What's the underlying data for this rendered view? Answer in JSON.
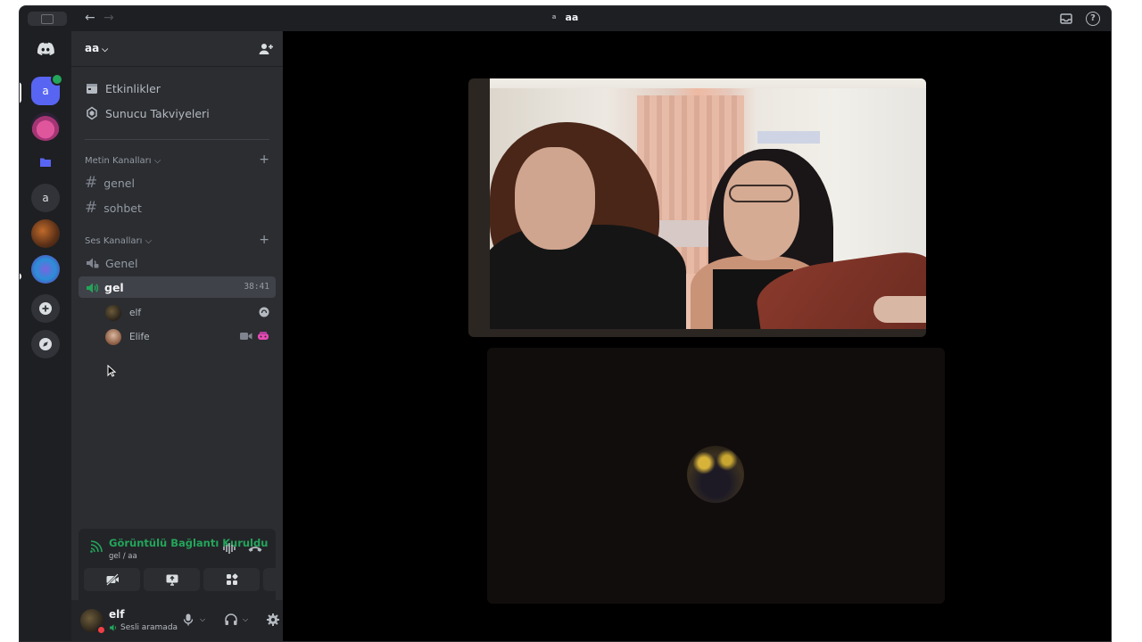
{
  "titlebar": {
    "title": "aa",
    "title_mini": "a",
    "back": "←",
    "forward": "→",
    "help": "?"
  },
  "server_rail": {
    "servers": [
      {
        "label": "a",
        "name": "aa",
        "active": true
      },
      {
        "label": "a",
        "name": "a"
      }
    ],
    "add": "+"
  },
  "server": {
    "name": "aa"
  },
  "nav": {
    "events": "Etkinlikler",
    "boosts": "Sunucu Takviyeleri"
  },
  "categories": {
    "text": "Metin Kanalları",
    "voice": "Ses Kanalları",
    "add": "+"
  },
  "text_channels": [
    "genel",
    "sohbet"
  ],
  "voice_channels": [
    {
      "name": "Genel"
    },
    {
      "name": "gel",
      "active": true,
      "timer": "38:41"
    }
  ],
  "voice_users": [
    {
      "name": "elf"
    },
    {
      "name": "Elife"
    }
  ],
  "voice_panel": {
    "status": "Görüntülü Bağlantı Kuruldu",
    "channel_path": "gel / aa"
  },
  "user_panel": {
    "name": "elf",
    "status": "Sesli aramada"
  },
  "colors": {
    "accent": "#5865f2",
    "connected": "#23a55a",
    "dnd": "#f23f43",
    "background": "#1e1f22",
    "sidebar": "#2b2d31",
    "main": "#000000"
  }
}
